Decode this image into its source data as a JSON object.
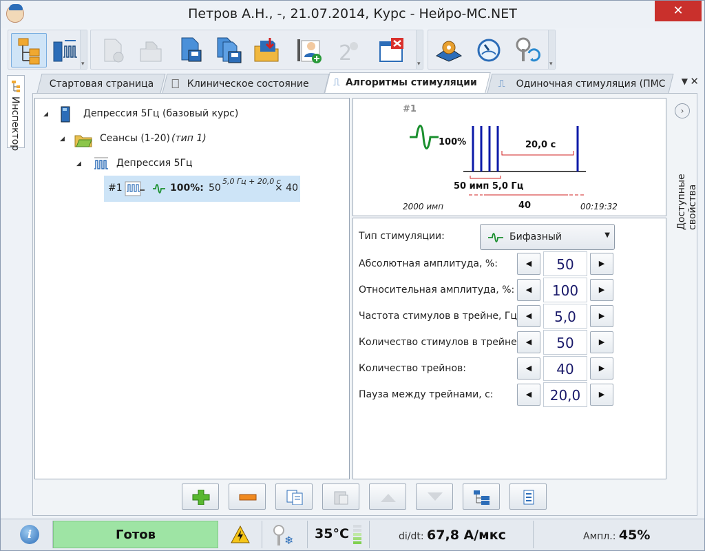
{
  "window": {
    "title": "Петров А.Н., -, 21.07.2014, Курс - Нейро-МС.NET",
    "close": "✕"
  },
  "toolbar": {
    "items": [
      "tree-view",
      "session-stimulation",
      "new-document",
      "export",
      "save",
      "save-all",
      "save-to-folder",
      "add-patient",
      "add-duplicate",
      "close-window",
      "device-settings",
      "coil-calibration",
      "coil-change"
    ]
  },
  "inspector": {
    "label": "Инспектор"
  },
  "tabs": [
    {
      "label": "Стартовая страница"
    },
    {
      "label": "Клиническое состояние"
    },
    {
      "label": "Алгоритмы стимуляции"
    },
    {
      "label": "Одиночная стимуляция (ПМС"
    }
  ],
  "tree": {
    "root": "Депрессия 5Гц (базовый курс)",
    "sessions": "Сеансы (1-20)",
    "sessions_type": "(тип 1)",
    "protocol": "Депрессия 5Гц",
    "item_index": "#1",
    "item_percent": "100%:",
    "item_count": "50",
    "item_sup": "5,0 Гц + 20,0 с",
    "item_repeat": "× 40"
  },
  "preview": {
    "index": "#1",
    "percent": "100%",
    "pause": "20,0 с",
    "train": "50 имп 5,0 Гц",
    "total_pulses": "2000 имп",
    "trains": "40",
    "duration": "00:19:32"
  },
  "props": {
    "type_label": "Тип стимуляции:",
    "type_value": "Бифазный",
    "rows": [
      {
        "label": "Абсолютная амплитуда, %:",
        "value": "50"
      },
      {
        "label": "Относительная амплитуда, %:",
        "value": "100"
      },
      {
        "label": "Частота стимулов в трейне, Гц:",
        "value": "5,0"
      },
      {
        "label": "Количество стимулов в трейне:",
        "value": "50"
      },
      {
        "label": "Количество трейнов:",
        "value": "40"
      },
      {
        "label": "Пауза между трейнами, с:",
        "value": "20,0"
      }
    ]
  },
  "right_panel": {
    "label": "Доступные свойства"
  },
  "bottom_buttons": [
    "add",
    "remove",
    "copy",
    "paste",
    "move-up",
    "move-down",
    "expand",
    "collapse"
  ],
  "status": {
    "ready": "Готов",
    "temperature": "35°C",
    "didt_label": "di/dt:",
    "didt_value": "67,8 А/мкс",
    "ampl_label": "Ампл.:",
    "ampl_value": "45%"
  },
  "colors": {
    "accent": "#2c6db8",
    "ready": "#9ee4a4",
    "wave": "#1a8f2e",
    "pulse": "#0b1aa8",
    "close": "#c9302c"
  }
}
